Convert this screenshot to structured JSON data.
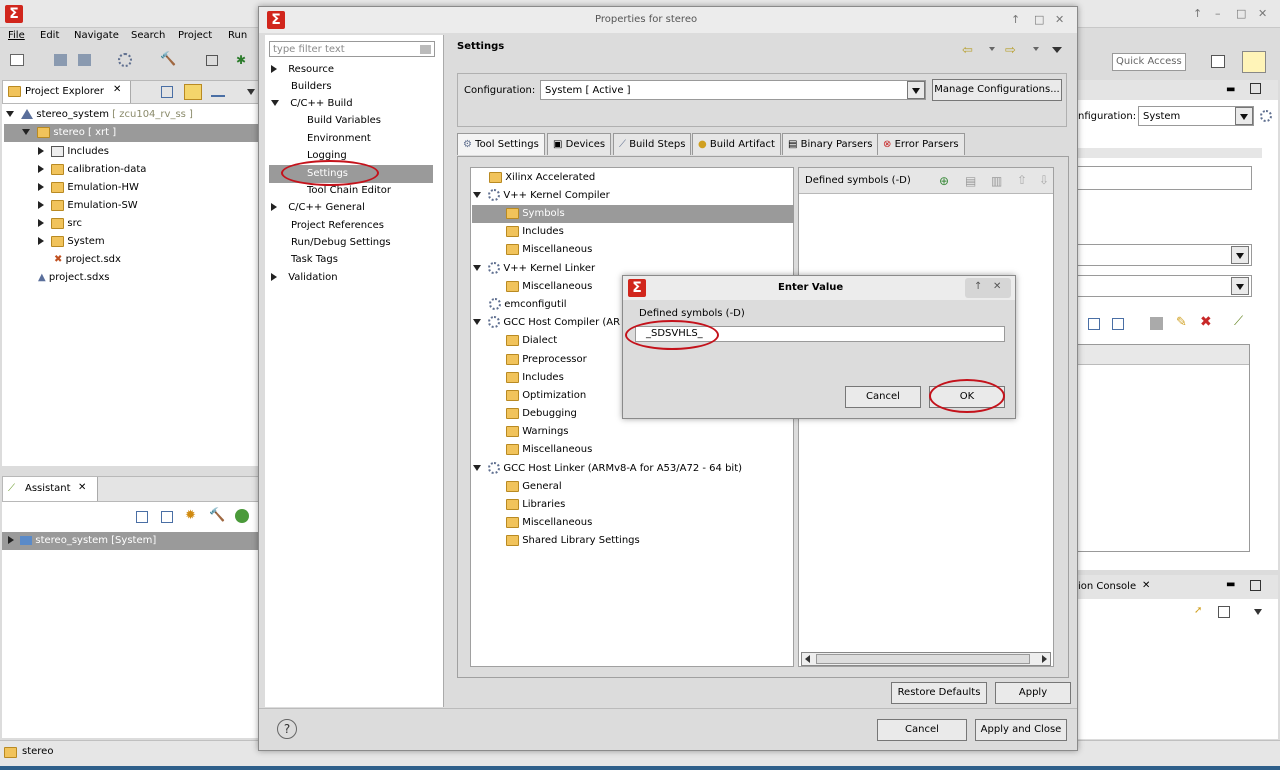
{
  "main": {
    "menu": [
      "File",
      "Edit",
      "Navigate",
      "Search",
      "Project",
      "Run"
    ],
    "quick_access": "Quick Access",
    "status_text": "stereo"
  },
  "explorer": {
    "title": "Project Explorer",
    "root": "stereo_system",
    "root_tag": "[ zcu104_rv_ss ]",
    "project": "stereo [ xrt ]",
    "items": [
      "Includes",
      "calibration-data",
      "Emulation-HW",
      "Emulation-SW",
      "src",
      "System",
      "project.sdx"
    ],
    "root_file": "project.sdxs"
  },
  "assistant": {
    "title": "Assistant",
    "item": "stereo_system [System]"
  },
  "right_bg": {
    "config_label": "nfiguration:",
    "config_value": "System",
    "console_title": "ion Console"
  },
  "dialog": {
    "title": "Properties for stereo",
    "filter_placeholder": "type filter text",
    "nav": [
      "Resource",
      "Builders",
      "C/C++ Build",
      "Build Variables",
      "Environment",
      "Logging",
      "Settings",
      "Tool Chain Editor",
      "C/C++ General",
      "Project References",
      "Run/Debug Settings",
      "Task Tags",
      "Validation"
    ],
    "page_title": "Settings",
    "config_label": "Configuration:",
    "config_value": "System  [ Active ]",
    "manage_btn": "Manage Configurations...",
    "tabs": [
      "Tool Settings",
      "Devices",
      "Build Steps",
      "Build Artifact",
      "Binary Parsers",
      "Error Parsers"
    ],
    "tree": [
      "Xilinx Accelerated",
      "V++ Kernel Compiler",
      "Symbols",
      "Includes",
      "Miscellaneous",
      "V++ Kernel Linker",
      "Miscellaneous",
      "emconfigutil",
      "GCC Host Compiler (AR",
      "Dialect",
      "Preprocessor",
      "Includes",
      "Optimization",
      "Debugging",
      "Warnings",
      "Miscellaneous",
      "GCC Host Linker (ARMv8-A for A53/A72 - 64 bit)",
      "General",
      "Libraries",
      "Miscellaneous",
      "Shared Library Settings"
    ],
    "symbols_header": "Defined symbols (-D)",
    "restore_btn": "Restore Defaults",
    "apply_btn": "Apply",
    "cancel_btn": "Cancel",
    "apply_close_btn": "Apply and Close",
    "help": "?"
  },
  "enter_value": {
    "title": "Enter Value",
    "label": "Defined symbols (-D)",
    "value": "_SDSVHLS_",
    "cancel": "Cancel",
    "ok": "OK"
  },
  "colors": {
    "accent_red": "#c4121b",
    "xilinx_red": "#d1261c",
    "selection": "#9a9a9a"
  }
}
